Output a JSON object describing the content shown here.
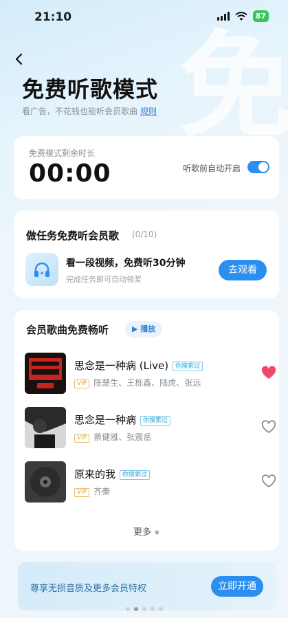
{
  "status_bar": {
    "time": "21:10",
    "battery": "87"
  },
  "header": {
    "title": "免费听歌模式",
    "subtitle": "看广告，不花钱也能听会员歌曲",
    "rules_link": "规则",
    "bg_char": "免"
  },
  "timer": {
    "label": "免费模式剩余时长",
    "value": "00:00",
    "auto_label": "听歌前自动开启",
    "auto_on": true
  },
  "task": {
    "title": "做任务免费听会员歌",
    "count": "(0/10)",
    "main": "看一段视频，免费听30分钟",
    "sub": "完成任务即可自动领奖",
    "button": "去观看"
  },
  "songs": {
    "title": "会员歌曲免费畅听",
    "play_label": "播放",
    "searched_tag": "你搜索过",
    "vip_tag": "VIP",
    "items": [
      {
        "name": "思念是一种病 (Live)",
        "artists": "陈楚生、王栎鑫、陆虎、张远",
        "liked": true
      },
      {
        "name": "思念是一种病",
        "artists": "蔡健雅、张震岳",
        "liked": false
      },
      {
        "name": "原来的我",
        "artists": "齐秦",
        "liked": false
      }
    ],
    "more_label": "更多"
  },
  "vip_banner": {
    "text": "尊享无损音质及更多会员特权",
    "button": "立即开通"
  },
  "colors": {
    "accent": "#2a8ff0",
    "liked": "#f0486b"
  }
}
